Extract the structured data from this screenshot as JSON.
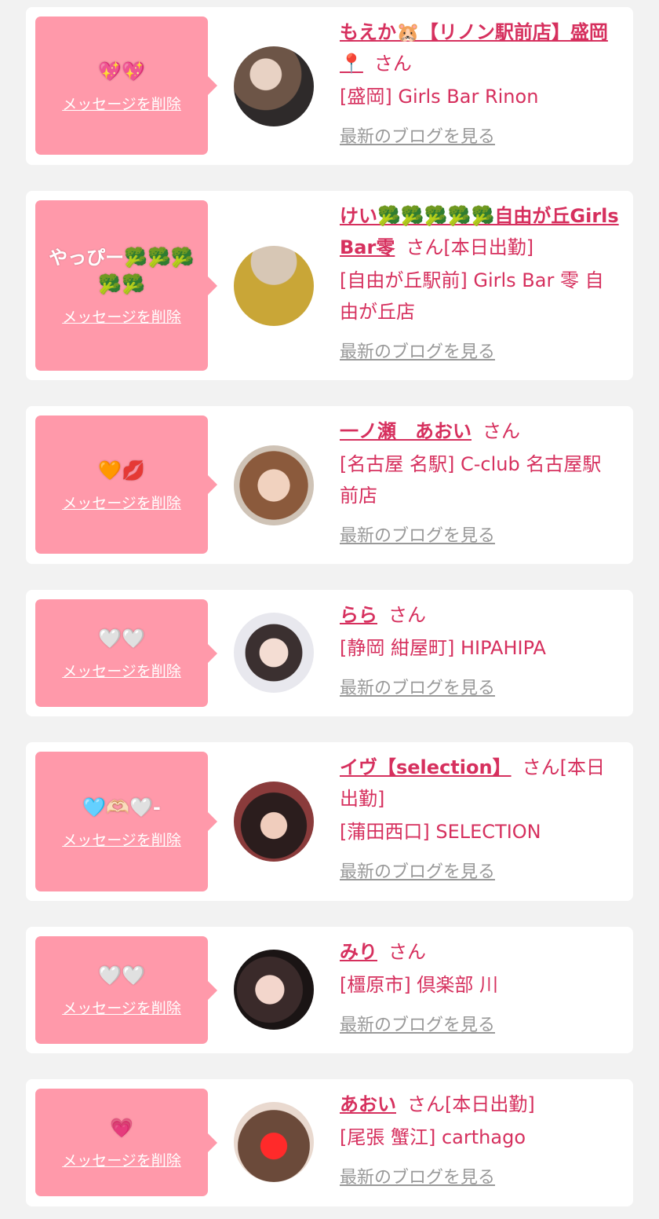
{
  "delete_label": "メッセージを削除",
  "san_label": "さん",
  "blog_label": "最新のブログを見る",
  "accent_color": "#d6305e",
  "bubble_color": "#ff99aa",
  "items": [
    {
      "message": "💖💖",
      "name": "もえか🐹【リノン駅前店】盛岡📍",
      "suffix": "",
      "shop": "[盛岡] Girls Bar Rinon"
    },
    {
      "message": "やっぴー🥦🥦🥦🥦🥦",
      "name": "けい🥦🥦🥦🥦🥦自由が丘Girls Bar零",
      "suffix": "[本日出勤]",
      "shop": "[自由が丘駅前] Girls Bar 零 自由が丘店"
    },
    {
      "message": "🧡💋",
      "name": "一ノ瀬　あおい",
      "suffix": "",
      "shop": "[名古屋 名駅] C-club 名古屋駅前店"
    },
    {
      "message": "🤍🤍",
      "name": "らら",
      "suffix": "",
      "shop": "[静岡 紺屋町] HIPAHIPA"
    },
    {
      "message": "🩵🫶🏻🤍-",
      "name": "イヴ【selection】",
      "suffix": "[本日出勤]",
      "shop": "[蒲田西口] SELECTION"
    },
    {
      "message": "🤍🤍",
      "name": "みり",
      "suffix": "",
      "shop": "[橿原市] 倶楽部 川"
    },
    {
      "message": "💗",
      "name": "あおい",
      "suffix": "[本日出勤]",
      "shop": "[尾張 蟹江] carthago"
    }
  ]
}
